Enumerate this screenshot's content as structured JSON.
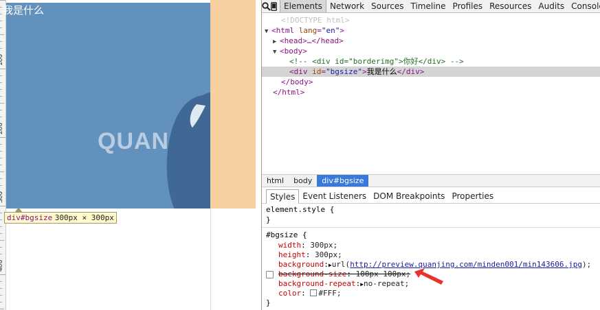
{
  "viewport": {
    "page_text": "我是什么",
    "watermark": "QUANJIN",
    "ruler_labels": [
      "100",
      "200",
      "300",
      "400"
    ],
    "tooltip": {
      "tag": "div#bgsize",
      "dims": "300px × 300px"
    },
    "colors": {
      "box": "#6391bd",
      "margin_tint": "#f8cfa0"
    }
  },
  "toolbar": {
    "icons": [
      "search-icon",
      "mobile-device-icon"
    ],
    "tabs": [
      "Elements",
      "Network",
      "Sources",
      "Timeline",
      "Profiles",
      "Resources",
      "Audits",
      "Console"
    ],
    "active_tab": "Elements"
  },
  "dom": {
    "doctype": "<!DOCTYPE html>",
    "html_open": "<html",
    "html_attr": "lang",
    "html_val": "\"en\"",
    "head": "<head>…</head>",
    "body_open": "<body>",
    "comment": "<!-- <div id=\"borderimg\">你好</div> -->",
    "div_open": "<div",
    "div_attr": "id",
    "div_val": "\"bgsize\"",
    "div_text": "我是什么",
    "div_close": "</div>",
    "body_close": "</body>",
    "html_close": "</html>"
  },
  "breadcrumb": [
    "html",
    "body",
    "div#bgsize"
  ],
  "sub_tabs": [
    "Styles",
    "Event Listeners",
    "DOM Breakpoints",
    "Properties"
  ],
  "styles": {
    "element_style": "element.style {",
    "close": "}",
    "selector": "#bgsize {",
    "props": [
      {
        "name": "width",
        "value": "300px;"
      },
      {
        "name": "height",
        "value": "300px;"
      },
      {
        "name": "background",
        "value_prefix": "url(",
        "link": "http://preview.quanjing.com/minden001/min143606.jpg",
        "value_suffix": ");"
      },
      {
        "name": "background-size",
        "value": "100px 100px;"
      },
      {
        "name": "background-repeat",
        "value": "no-repeat;"
      },
      {
        "name": "color",
        "value": "#FFF;"
      }
    ]
  },
  "annotation_color": "#e8322b"
}
